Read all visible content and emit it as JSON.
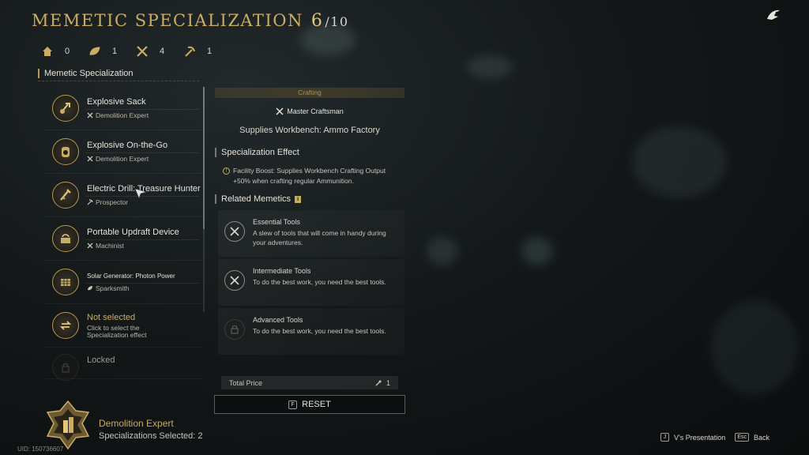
{
  "header": {
    "title": "MEMETIC SPECIALIZATION",
    "count": "6",
    "max": "/10"
  },
  "stats": [
    {
      "icon": "home-icon",
      "value": "0"
    },
    {
      "icon": "leaf-icon",
      "value": "1"
    },
    {
      "icon": "tools-icon",
      "value": "4"
    },
    {
      "icon": "pickaxe-icon",
      "value": "1"
    }
  ],
  "list": {
    "heading": "Memetic Specialization",
    "items": [
      {
        "name": "Explosive Sack",
        "sub": "Demolition Expert"
      },
      {
        "name": "Explosive On-the-Go",
        "sub": "Demolition Expert"
      },
      {
        "name": "Electric Drill: Treasure Hunter",
        "sub": "Prospector"
      },
      {
        "name": "Portable Updraft Device",
        "sub": "Machinist"
      },
      {
        "name": "Solar Generator: Photon Power",
        "sub": "Sparksmith"
      },
      {
        "name": "Not selected",
        "sub": "Click to select the Specialization effect"
      },
      {
        "name": "Locked",
        "sub": ""
      }
    ]
  },
  "detail": {
    "category": "Crafting",
    "master": "Master Craftsman",
    "workbench": "Supplies Workbench: Ammo Factory",
    "effect_heading": "Specialization Effect",
    "effect_text": "Facility Boost: Supplies Workbench Crafting Output +50% when crafting regular Ammunition.",
    "related_heading": "Related Memetics",
    "memetics": [
      {
        "name": "Essential Tools",
        "desc": "A slew of tools that will come in handy during your adventures."
      },
      {
        "name": "Intermediate Tools",
        "desc": "To do the best work, you need the best tools."
      },
      {
        "name": "Advanced Tools",
        "desc": "To do the best work, you need the best tools."
      }
    ],
    "total_label": "Total Price",
    "total_value": "1",
    "reset_key": "F",
    "reset_label": "RESET"
  },
  "selected": {
    "name": "Demolition Expert",
    "count_text": "Specializations Selected: 2"
  },
  "uid": "UID: 150736607",
  "footer": {
    "presentation_key": "J",
    "presentation_label": "V's Presentation",
    "back_key": "Esc",
    "back_label": "Back"
  },
  "colors": {
    "accent": "#c9ad62",
    "background": "#141819"
  }
}
